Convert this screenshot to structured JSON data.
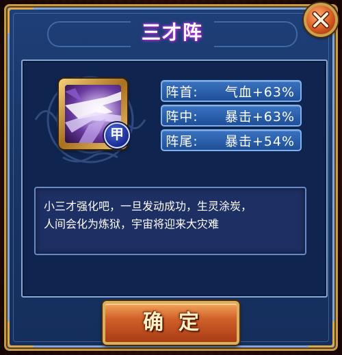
{
  "dialog": {
    "title": "三才阵"
  },
  "close_button": {
    "icon": "close-x-icon"
  },
  "skill": {
    "icon": "lightning-claw-skill-icon",
    "badge": "甲"
  },
  "stats": [
    {
      "label": "阵首:",
      "value": "气血+63%"
    },
    {
      "label": "阵中:",
      "value": "暴击+63%"
    },
    {
      "label": "阵尾:",
      "value": "暴击+54%"
    }
  ],
  "description": {
    "line1": "小三才强化吧，一旦发动成功，生灵涂炭，",
    "line2": "人间会化为炼狱，宇宙将迎来大灾难"
  },
  "confirm_button": {
    "label": "确定"
  },
  "colors": {
    "panel_blue": "#183566",
    "gold_border": "#c79a45",
    "stat_blue": "#2f63b0",
    "title_glow": "#b040e0",
    "button_orange": "#d0602a"
  }
}
